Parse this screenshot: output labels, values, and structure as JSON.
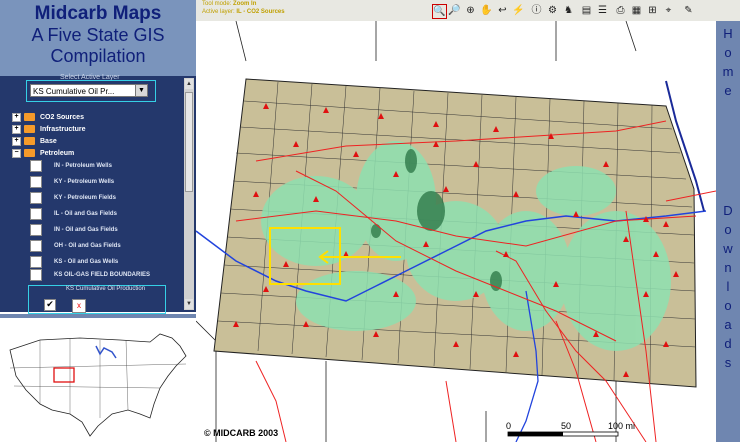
{
  "header": {
    "title_line1": "Midcarb Maps",
    "title_line2": "A Five State GIS",
    "title_line3": "Compilation"
  },
  "toolbar": {
    "tool_mode_label": "Tool mode:",
    "tool_mode_value": "Zoom In",
    "active_layer_label": "Active layer:",
    "active_layer_value": "IL - CO2 Sources",
    "tools": [
      "zoom-in",
      "zoom-out",
      "zoom-full",
      "pan",
      "back",
      "identify",
      "info",
      "query",
      "find",
      "legend",
      "layers",
      "print",
      "extent",
      "select",
      "clear"
    ]
  },
  "layer_panel": {
    "select_label": "Select Active Layer",
    "selected_layer": "KS Cumulative Oil Pr...",
    "groups": [
      {
        "label": "CO2 Sources"
      },
      {
        "label": "Infrastructure"
      },
      {
        "label": "Base"
      },
      {
        "label": "Petroleum"
      }
    ],
    "layers": [
      {
        "label": "IN - Petroleum Wells"
      },
      {
        "label": "KY - Petroleum Wells"
      },
      {
        "label": "KY - Petroleum Fields"
      },
      {
        "label": "IL - Oil and Gas Fields"
      },
      {
        "label": "IN - Oil and Gas Fields"
      },
      {
        "label": "OH - Oil and Gas Fields"
      },
      {
        "label": "KS - Oil and Gas Wells"
      },
      {
        "label": "KS OIL-GAS FIELD BOUNDARIES"
      }
    ],
    "active_layer": {
      "label": "KS Cumulative Oil Production",
      "checked": "✔",
      "legend_symbol": "x"
    }
  },
  "map": {
    "scale_ticks": [
      "0",
      "50",
      "100 mi"
    ],
    "copyright": "© MIDCARB 2003",
    "colors": {
      "land": "#c9bf98",
      "oil": "#8ee0b0",
      "roads": "#e22",
      "rivers": "#2244dd",
      "highlight": "#ffe000"
    }
  },
  "right_nav": {
    "home_letters": [
      "H",
      "o",
      "m",
      "e"
    ],
    "downloads_letters": [
      "D",
      "o",
      "w",
      "n",
      "l",
      "o",
      "a",
      "d",
      "s"
    ]
  }
}
